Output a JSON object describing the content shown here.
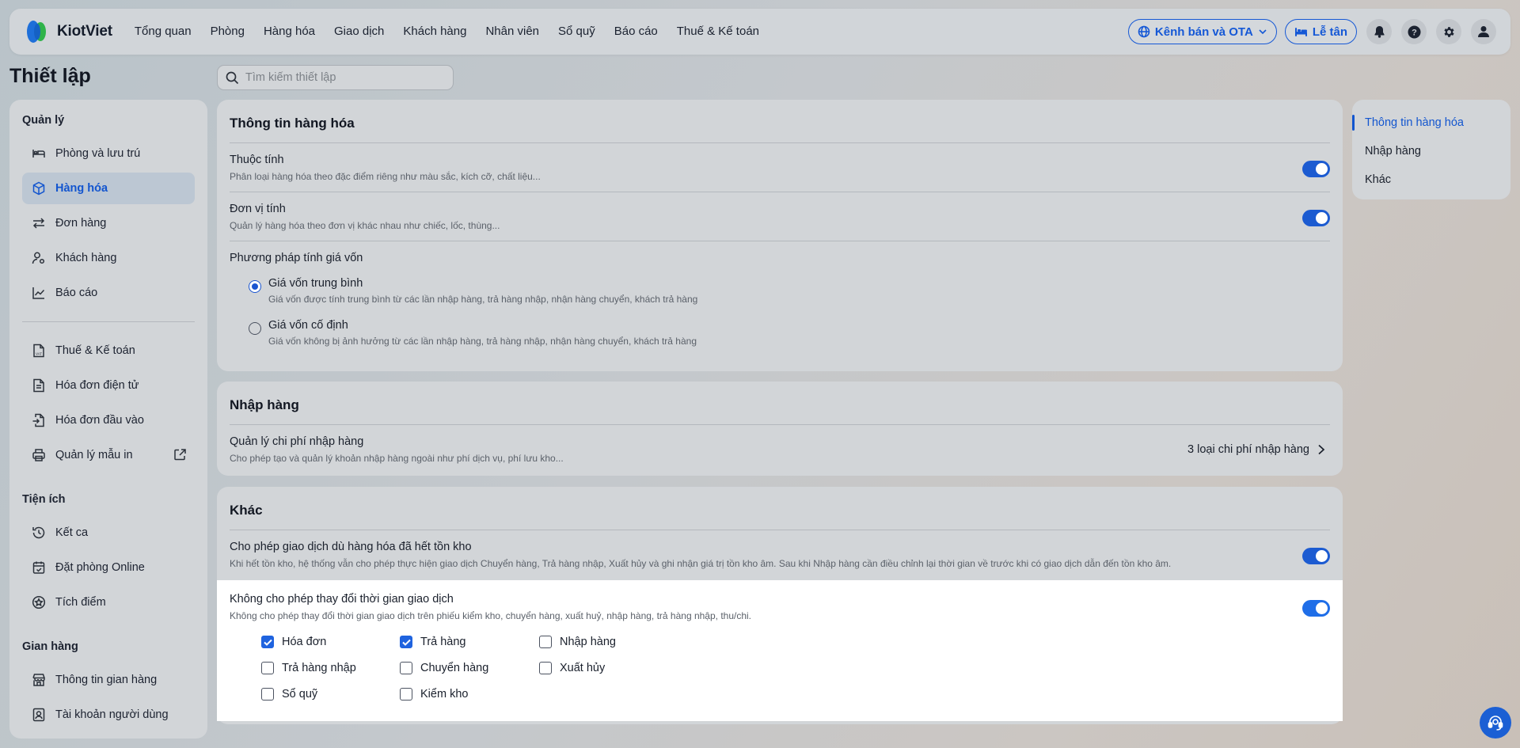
{
  "brand": {
    "name": "KiotViet"
  },
  "nav": {
    "items": [
      {
        "label": "Tổng quan"
      },
      {
        "label": "Phòng"
      },
      {
        "label": "Hàng hóa"
      },
      {
        "label": "Giao dịch"
      },
      {
        "label": "Khách hàng"
      },
      {
        "label": "Nhân viên"
      },
      {
        "label": "Sổ quỹ"
      },
      {
        "label": "Báo cáo"
      },
      {
        "label": "Thuế & Kế toán"
      }
    ],
    "channel_button": "Kênh bán và OTA",
    "reception_button": "Lễ tân"
  },
  "page": {
    "title": "Thiết lập",
    "search_placeholder": "Tìm kiếm thiết lập"
  },
  "sidebar": {
    "groups": [
      {
        "title": "Quản lý",
        "items": [
          {
            "label": "Phòng và lưu trú",
            "icon": "bed-icon"
          },
          {
            "label": "Hàng hóa",
            "icon": "cube-icon",
            "active": true
          },
          {
            "label": "Đơn hàng",
            "icon": "swap-arrows-icon"
          },
          {
            "label": "Khách hàng",
            "icon": "user-icon"
          },
          {
            "label": "Báo cáo",
            "icon": "chart-line-icon"
          }
        ],
        "items2": [
          {
            "label": "Thuế & Kế toán",
            "icon": "vat-document-icon"
          },
          {
            "label": "Hóa đơn điện tử",
            "icon": "document-icon"
          },
          {
            "label": "Hóa đơn đầu vào",
            "icon": "document-import-icon"
          },
          {
            "label": "Quản lý mẫu in",
            "icon": "printer-icon"
          }
        ]
      },
      {
        "title": "Tiện ích",
        "items": [
          {
            "label": "Kết ca",
            "icon": "history-icon"
          },
          {
            "label": "Đặt phòng Online",
            "icon": "calendar-check-icon"
          },
          {
            "label": "Tích điểm",
            "icon": "star-circle-icon"
          }
        ]
      },
      {
        "title": "Gian hàng",
        "items": [
          {
            "label": "Thông tin gian hàng",
            "icon": "store-icon"
          },
          {
            "label": "Tài khoản người dùng",
            "icon": "user-badge-icon"
          }
        ]
      }
    ]
  },
  "product_info": {
    "title": "Thông tin hàng hóa",
    "attributes": {
      "title": "Thuộc tính",
      "desc": "Phân loại hàng hóa theo đặc điểm riêng như màu sắc, kích cỡ, chất liệu...",
      "enabled": true
    },
    "units": {
      "title": "Đơn vị tính",
      "desc": "Quản lý hàng hóa theo đơn vị khác nhau như chiếc, lốc, thùng...",
      "enabled": true
    },
    "cost_method": {
      "title": "Phương pháp tính giá vốn",
      "options": [
        {
          "title": "Giá vốn trung bình",
          "desc": "Giá vốn được tính trung bình từ các lần nhập hàng, trả hàng nhập, nhận hàng chuyển, khách trả hàng",
          "selected": true
        },
        {
          "title": "Giá vốn cố định",
          "desc": "Giá vốn không bị ảnh hưởng từ các lần nhập hàng, trả hàng nhập, nhận hàng chuyển, khách trả hàng",
          "selected": false
        }
      ]
    }
  },
  "import": {
    "title": "Nhập hàng",
    "cost_mgmt": {
      "title": "Quản lý chi phí nhập hàng",
      "desc": "Cho phép tạo và quản lý khoản nhập hàng ngoài như phí dịch vụ, phí lưu kho...",
      "link": "3 loại chi phí nhập hàng"
    }
  },
  "other": {
    "title": "Khác",
    "allow_out_of_stock": {
      "title": "Cho phép giao dịch dù hàng hóa đã hết tồn kho",
      "desc": "Khi hết tồn kho, hệ thống vẫn cho phép thực hiện giao dịch Chuyển hàng, Trả hàng nhập, Xuất hủy và ghi nhận giá trị tồn kho âm. Sau khi Nhập hàng cần điều chỉnh lại thời gian về trước khi có giao dịch dẫn đến tồn kho âm.",
      "enabled": true
    },
    "lock_time": {
      "title": "Không cho phép thay đổi thời gian giao dịch",
      "desc": "Không cho phép thay đổi thời gian giao dịch trên phiếu kiểm kho, chuyển hàng, xuất huỷ, nhập hàng, trả hàng nhập, thu/chi.",
      "enabled": true,
      "options": [
        {
          "label": "Hóa đơn",
          "checked": true
        },
        {
          "label": "Trả hàng",
          "checked": true
        },
        {
          "label": "Nhập hàng",
          "checked": false
        },
        {
          "label": "Trả hàng nhập",
          "checked": false
        },
        {
          "label": "Chuyển hàng",
          "checked": false
        },
        {
          "label": "Xuất hủy",
          "checked": false
        },
        {
          "label": "Sổ quỹ",
          "checked": false
        },
        {
          "label": "Kiểm kho",
          "checked": false
        }
      ]
    }
  },
  "anchors": [
    {
      "label": "Thông tin hàng hóa",
      "active": true
    },
    {
      "label": "Nhập hàng"
    },
    {
      "label": "Khác"
    }
  ],
  "colors": {
    "accent": "#1255cf",
    "toggle_on": "#1c5bd1"
  }
}
